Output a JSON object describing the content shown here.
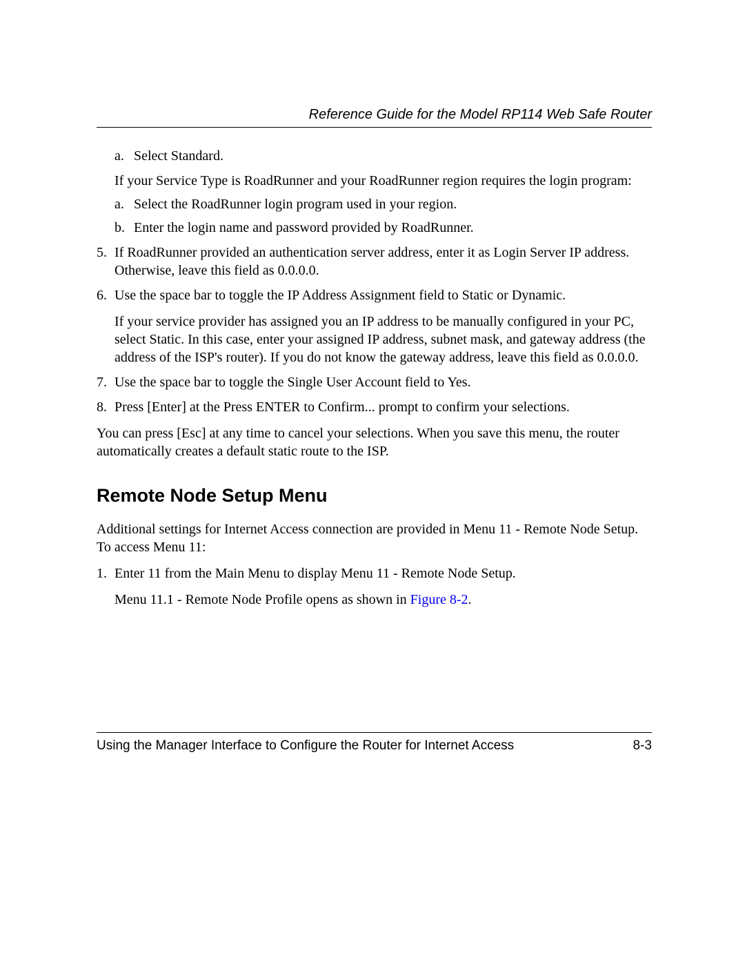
{
  "header": {
    "title": "Reference Guide for the Model RP114 Web Safe Router"
  },
  "sublist1": {
    "a": {
      "marker": "a.",
      "text": "Select Standard."
    }
  },
  "conditional": "If your Service Type is RoadRunner and your RoadRunner region requires the login program:",
  "sublist2": {
    "a": {
      "marker": "a.",
      "text": "Select the RoadRunner login program used in your region."
    },
    "b": {
      "marker": "b.",
      "text": "Enter the login name and password provided by RoadRunner."
    }
  },
  "numbered": {
    "n5": {
      "num": "5.",
      "text": "If RoadRunner provided an authentication server address, enter it as Login Server IP address. Otherwise, leave this field as 0.0.0.0."
    },
    "n6": {
      "num": "6.",
      "text": "Use the space bar to toggle the IP Address Assignment field to Static or Dynamic.",
      "para": "If your service provider has assigned you an IP address to be manually configured in your PC, select Static. In this case, enter your assigned IP address, subnet mask, and gateway address (the address of the ISP's router). If you do not know the gateway address, leave this field as 0.0.0.0."
    },
    "n7": {
      "num": "7.",
      "text": "Use the space bar to toggle the Single User Account field to Yes."
    },
    "n8": {
      "num": "8.",
      "text": "Press [Enter] at the Press ENTER to Confirm... prompt to confirm your selections."
    }
  },
  "closing": "You can press [Esc] at any time to cancel your selections. When you save this menu, the router automatically creates a default static route to the ISP.",
  "section_heading": "Remote Node Setup Menu",
  "section_intro": "Additional settings for Internet Access connection are provided in Menu 11 - Remote Node Setup. To access Menu 11:",
  "section_steps": {
    "n1": {
      "num": "1.",
      "text": "Enter 11 from the Main Menu to display Menu 11 - Remote Node Setup.",
      "para_pre": "Menu 11.1 - Remote Node Profile opens as shown in ",
      "para_link": "Figure 8-2",
      "para_post": "."
    }
  },
  "footer": {
    "left": "Using the Manager Interface to Configure the Router for Internet Access",
    "right": "8-3"
  }
}
